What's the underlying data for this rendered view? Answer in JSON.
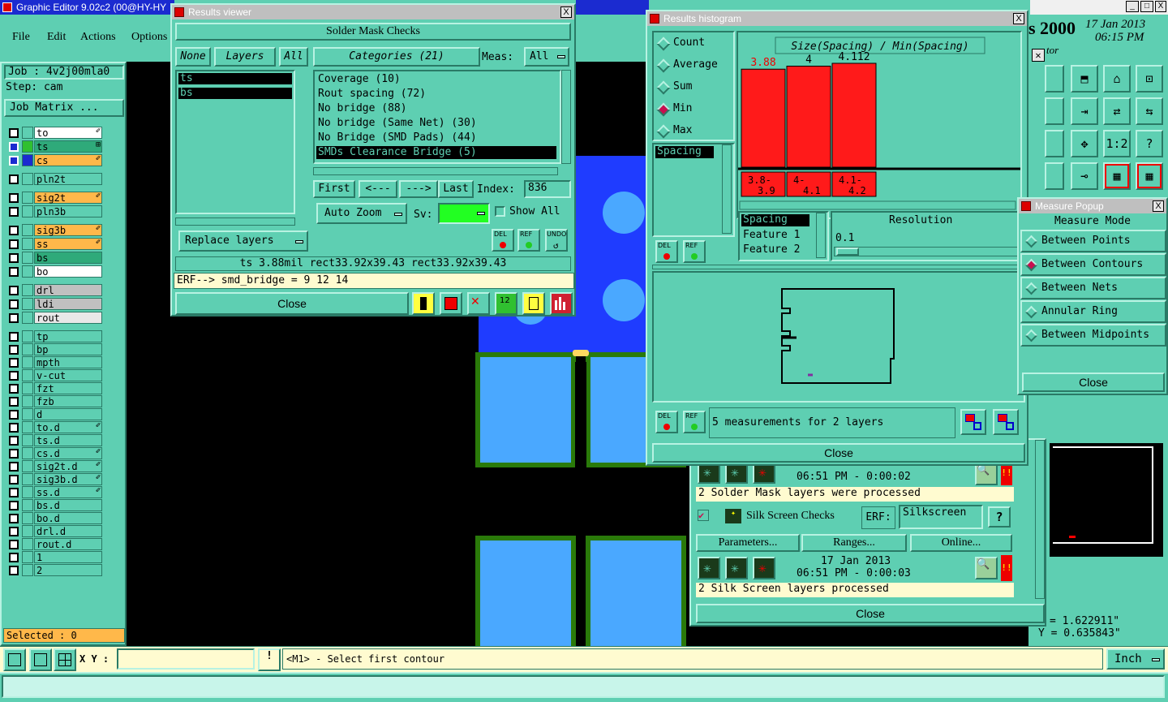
{
  "app": {
    "title": "Graphic Editor 9.02c2 (00@HY-HY"
  },
  "menu": [
    "File",
    "Edit",
    "Actions",
    "Options"
  ],
  "job": {
    "job_label": "Job :",
    "job_value": "4v2j00mla0",
    "step_label": "Step:",
    "step_value": "cam",
    "matrix_label": "Job Matrix ..."
  },
  "layers": [
    {
      "name": "to",
      "color": "#ffffff",
      "mark": "✐"
    },
    {
      "name": "ts",
      "color": "#2faa7a",
      "mark": "⊞"
    },
    {
      "name": "cs",
      "color": "#ffb84a",
      "mark": "✐"
    },
    {
      "name": "pln2t",
      "color": "#5ecfb2",
      "mark": ""
    },
    {
      "name": "sig2t",
      "color": "#ffb84a",
      "mark": "✐"
    },
    {
      "name": "pln3b",
      "color": "#5ecfb2",
      "mark": ""
    },
    {
      "name": "sig3b",
      "color": "#ffb84a",
      "mark": "✐"
    },
    {
      "name": "ss",
      "color": "#ffb84a",
      "mark": "✐"
    },
    {
      "name": "bs",
      "color": "#2faa7a",
      "mark": ""
    },
    {
      "name": "bo",
      "color": "#ffffff",
      "mark": ""
    },
    {
      "name": "drl",
      "color": "#c0c0c0",
      "mark": ""
    },
    {
      "name": "ldi",
      "color": "#c0c0c0",
      "mark": ""
    },
    {
      "name": "rout",
      "color": "#e8e8e8",
      "mark": ""
    },
    {
      "name": "tp",
      "color": "#5ecfb2",
      "mark": ""
    },
    {
      "name": "bp",
      "color": "#5ecfb2",
      "mark": ""
    },
    {
      "name": "mpth",
      "color": "#5ecfb2",
      "mark": ""
    },
    {
      "name": "v-cut",
      "color": "#5ecfb2",
      "mark": ""
    },
    {
      "name": "fzt",
      "color": "#5ecfb2",
      "mark": ""
    },
    {
      "name": "fzb",
      "color": "#5ecfb2",
      "mark": ""
    },
    {
      "name": "d",
      "color": "#5ecfb2",
      "mark": ""
    },
    {
      "name": "to.d",
      "color": "#5ecfb2",
      "mark": "✐"
    },
    {
      "name": "ts.d",
      "color": "#5ecfb2",
      "mark": ""
    },
    {
      "name": "cs.d",
      "color": "#5ecfb2",
      "mark": "✐"
    },
    {
      "name": "sig2t.d",
      "color": "#5ecfb2",
      "mark": "✐"
    },
    {
      "name": "sig3b.d",
      "color": "#5ecfb2",
      "mark": "✐"
    },
    {
      "name": "ss.d",
      "color": "#5ecfb2",
      "mark": "✐"
    },
    {
      "name": "bs.d",
      "color": "#5ecfb2",
      "mark": ""
    },
    {
      "name": "bo.d",
      "color": "#5ecfb2",
      "mark": ""
    },
    {
      "name": "drl.d",
      "color": "#5ecfb2",
      "mark": ""
    },
    {
      "name": "rout.d",
      "color": "#5ecfb2",
      "mark": ""
    },
    {
      "name": "1",
      "color": "#5ecfb2",
      "mark": ""
    },
    {
      "name": "2",
      "color": "#5ecfb2",
      "mark": ""
    }
  ],
  "selected": "Selected : 0",
  "statusbar": {
    "xy_label": "X Y :",
    "prompt": "<M1> - Select first contour",
    "units": "Inch"
  },
  "topright": {
    "title_frag": "s 2000",
    "date": "17 Jan 2013",
    "time": "06:15 PM",
    "sub": "tor"
  },
  "coords": {
    "x": "= 1.622911\"",
    "y": "Y = 0.635843\""
  },
  "results_viewer": {
    "title": "Results viewer",
    "header": "Solder Mask Checks",
    "none": "None",
    "layers_btn": "Layers",
    "all": "All",
    "layer_list": [
      "ts",
      "bs"
    ],
    "categories_btn": "Categories (21)",
    "meas_label": "Meas:",
    "meas_value": "All",
    "categories": [
      "Coverage (10)",
      "Rout spacing (72)",
      "No bridge (88)",
      "No bridge (Same Net) (30)",
      "No Bridge (SMD Pads) (44)",
      "SMDs Clearance Bridge (5)"
    ],
    "first": "First",
    "prev": "<---",
    "next": "--->",
    "last": "Last",
    "index_label": "Index:",
    "index_value": "836",
    "autozoom": "Auto Zoom",
    "sv_label": "Sv:",
    "show_all": "Show All",
    "replace": "Replace layers",
    "del": "DEL",
    "ref": "REF",
    "undo": "UNDO",
    "measure_line": "ts 3.88mil   rect33.92x39.43   rect33.92x39.43",
    "erf_line": "ERF--> smd_bridge = 9 12 14",
    "close": "Close"
  },
  "histogram": {
    "title": "Results histogram",
    "modes": [
      "Count",
      "Average",
      "Sum",
      "Min",
      "Max"
    ],
    "mode_selected": "Min",
    "spacing_item": "Spacing",
    "chart_title": "Size(Spacing) / Min(Spacing)",
    "chart_data": {
      "type": "bar",
      "categories": [
        "3.8-3.9",
        "4-4.1",
        "4.1-4.2"
      ],
      "values": [
        3.88,
        4,
        4.112
      ],
      "value_labels": [
        "3.88",
        "4",
        "4.112"
      ],
      "title": "Size(Spacing) / Min(Spacing)",
      "colors": [
        "#ff1a1a",
        "#ff1a1a",
        "#ff1a1a"
      ],
      "grid": false
    },
    "bins_top": [
      "3.8-",
      "4-",
      "4.1-"
    ],
    "bins_bottom": [
      "3.9",
      "4.1",
      "4.2"
    ],
    "fields": [
      "Spacing",
      "Feature 1",
      "Feature 2"
    ],
    "resolution_label": "Resolution",
    "resolution_value": "0.1",
    "del": "DEL",
    "ref": "REF",
    "summary": "5 measurements for 2 layers",
    "close": "Close"
  },
  "measure_popup": {
    "title": "Measure Popup",
    "header": "Measure Mode",
    "items": [
      "Between Points",
      "Between Contours",
      "Between Nets",
      "Annular Ring",
      "Between Midpoints"
    ],
    "selected": "Between Contours",
    "close": "Close"
  },
  "checks": {
    "timestamp1": "06:51 PM - 0:00:02",
    "sm_processed": "2 Solder Mask layers were processed",
    "ss_title": "Silk Screen Checks",
    "erf_label": "ERF:",
    "erf_value": "Silkscreen",
    "help": "?",
    "params": "Parameters...",
    "ranges": "Ranges...",
    "online": "Online...",
    "date2": "17 Jan 2013",
    "timestamp2": "06:51 PM - 0:00:03",
    "ss_processed": "2 Silk Screen layers processed",
    "close": "Close",
    "warn": "!!"
  }
}
